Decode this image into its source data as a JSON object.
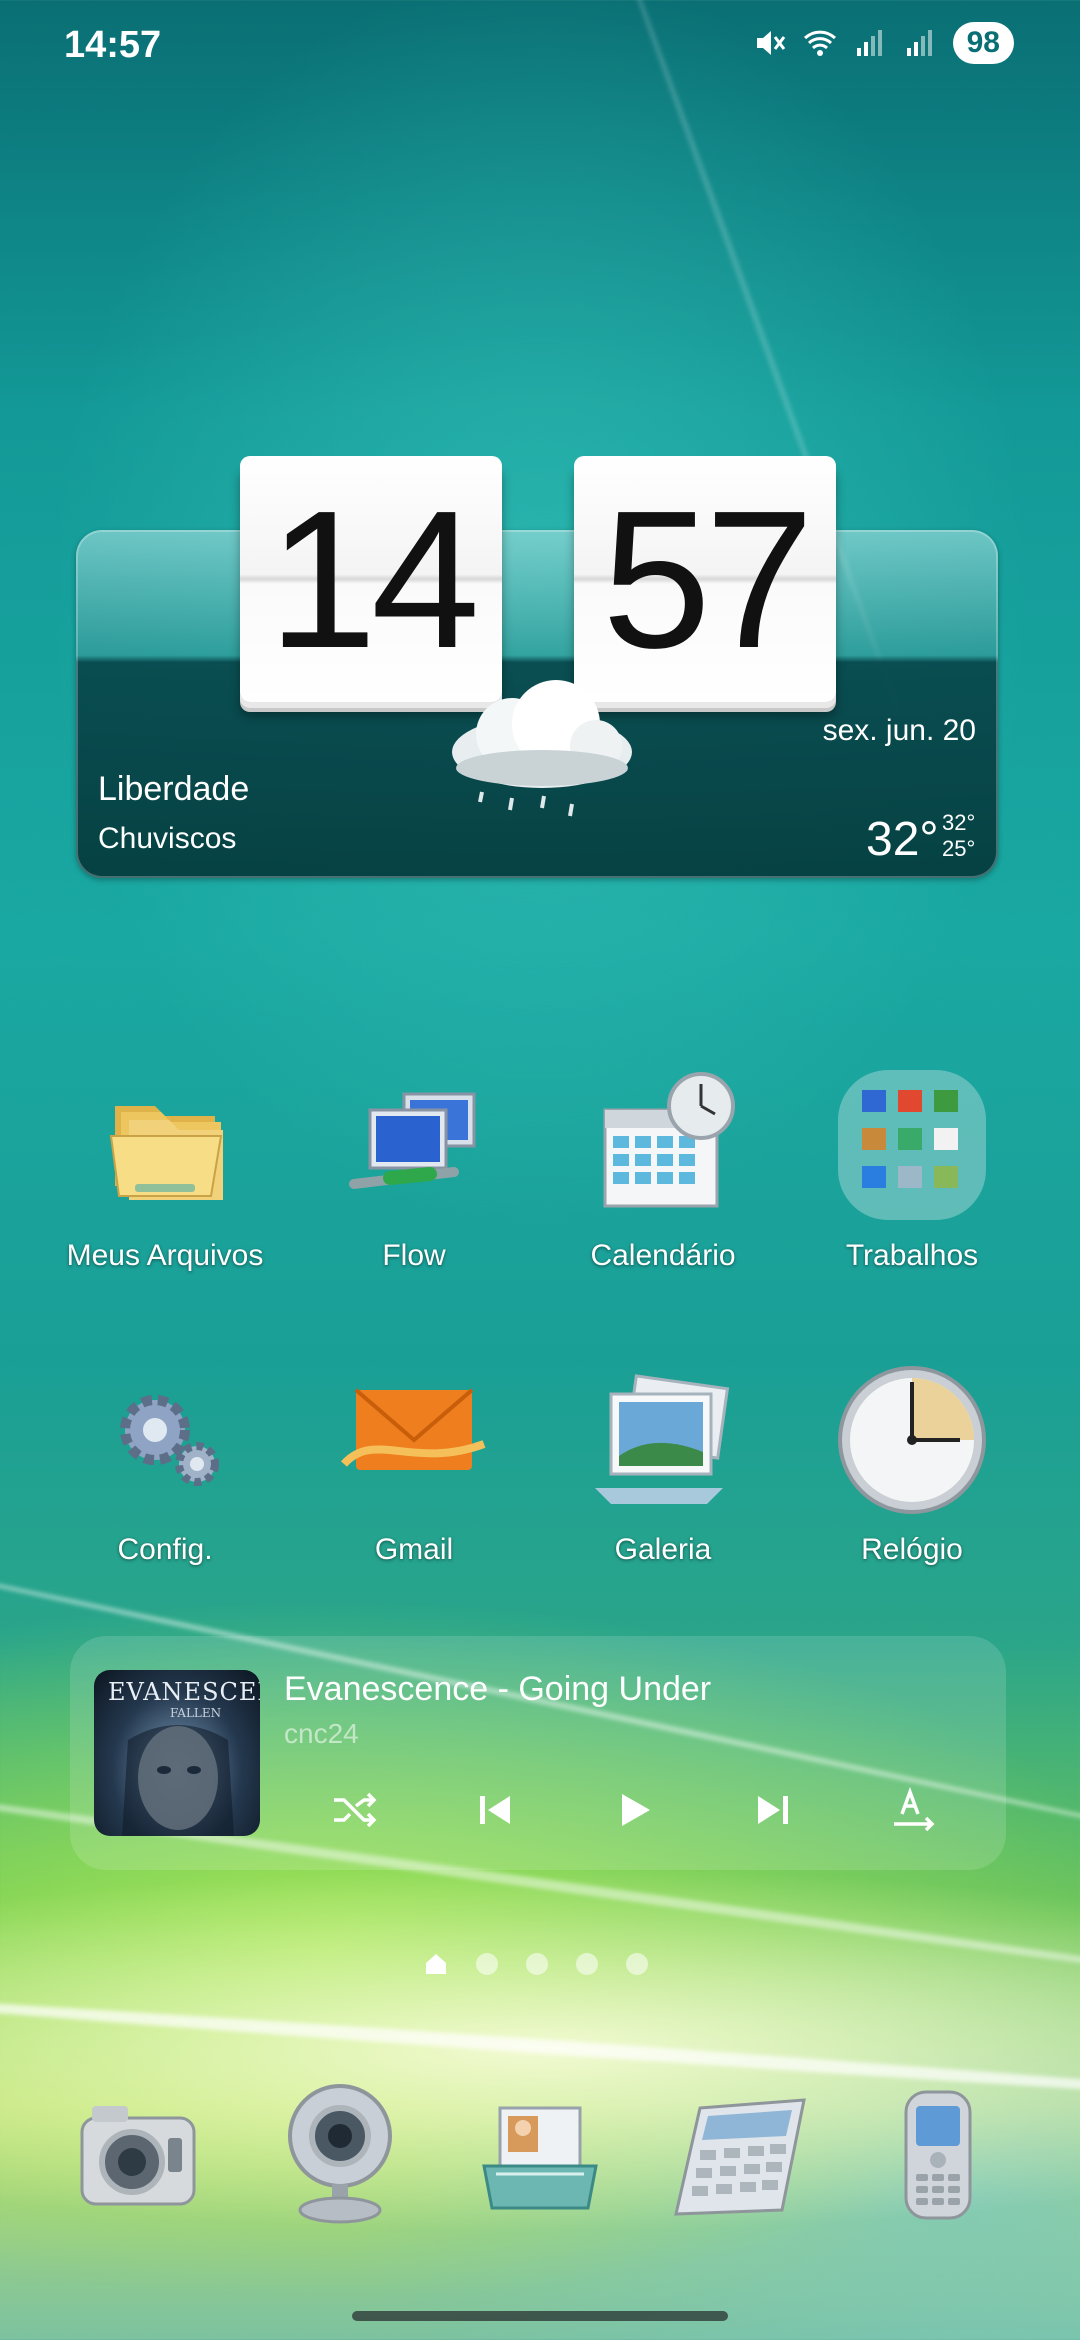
{
  "status_bar": {
    "time": "14:57",
    "icons": [
      "mute-icon",
      "wifi-icon",
      "signal-icon",
      "signal-icon"
    ],
    "battery": "98"
  },
  "clock_widget": {
    "hours": "14",
    "minutes": "57",
    "date": "sex. jun. 20",
    "city": "Liberdade",
    "condition": "Chuviscos",
    "temp": "32°",
    "high": "32°",
    "low": "25°",
    "weather_icon": "rain-cloud-icon"
  },
  "apps_row1": [
    {
      "label": "Meus Arquivos",
      "icon": "folder-icon"
    },
    {
      "label": "Flow",
      "icon": "network-icon"
    },
    {
      "label": "Calendário",
      "icon": "calendar-icon"
    },
    {
      "label": "Trabalhos",
      "icon": "folder-group-icon"
    }
  ],
  "apps_row2": [
    {
      "label": "Config.",
      "icon": "gear-icon"
    },
    {
      "label": "Gmail",
      "icon": "mail-icon"
    },
    {
      "label": "Galeria",
      "icon": "gallery-icon"
    },
    {
      "label": "Relógio",
      "icon": "clock-icon"
    }
  ],
  "music_player": {
    "album_text": "EVANESCENCE",
    "album_subtext": "FALLEN",
    "title": "Evanescence - Going Under",
    "artist": "cnc24",
    "controls": [
      "shuffle-icon",
      "previous-icon",
      "play-icon",
      "next-icon",
      "lyrics-icon"
    ]
  },
  "page_indicator": {
    "pages": 5,
    "current": 1
  },
  "dock": [
    "camera-icon",
    "webcam-icon",
    "contacts-icon",
    "calculator-icon",
    "phone-icon"
  ],
  "colors": {
    "accent": "#139a98",
    "text": "#ffffff"
  }
}
